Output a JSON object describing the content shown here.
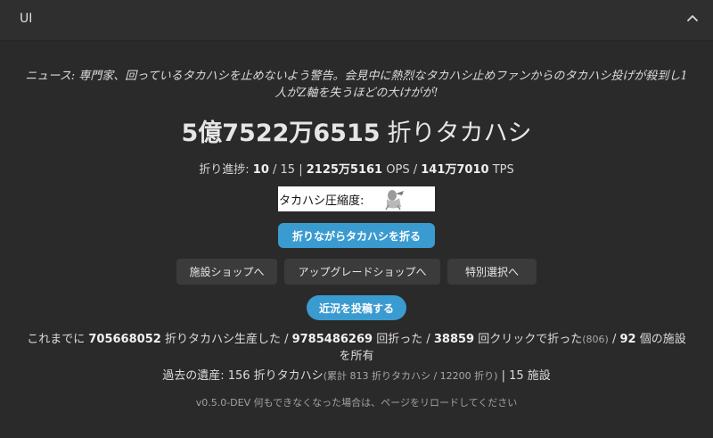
{
  "window": {
    "title": "UI"
  },
  "news": "ニュース: 専門家、回っているタカハシを止めないよう警告。会見中に熱烈なタカハシ止めファンからのタカハシ投げが殺到し1人がZ軸を失うほどの大けがが!",
  "counter": {
    "value": "5億7522万6515",
    "unit": "折りタカハシ"
  },
  "progress": {
    "label": "折り進捗:",
    "current": "10",
    "sep1": "/ 15 |",
    "ops": "2125万5161",
    "ops_unit": "OPS /",
    "tps": "141万7010",
    "tps_unit": "TPS"
  },
  "compress": {
    "label": "タカハシ圧縮度:"
  },
  "buttons": {
    "fold": "折りながらタカハシを折る",
    "facility_shop": "施設ショップへ",
    "upgrade_shop": "アップグレードショップへ",
    "special": "特別選択へ",
    "post": "近況を投稿する"
  },
  "stats": {
    "t1": "これまでに",
    "produced": "705668052",
    "t2": "折りタカハシ生産した /",
    "rotations": "9785486269",
    "t3": "回折った /",
    "clicks": "38859",
    "t4": "回クリックで折った",
    "clicks_paren": "(806)",
    "t5": "/",
    "facilities": "92",
    "t6": "個の施設を所有"
  },
  "legacy": {
    "label": "過去の遺産: 156 折りタカハシ",
    "detail": "(累計 813 折りタカハシ / 12200 折り)",
    "suffix": "| 15 施設"
  },
  "version": "v0.5.0-DEV 何もできなくなった場合は、ページをリロードしてください",
  "icons": {
    "collapse": "chevron-up-icon",
    "compress_image": "takahashi-figure-icon"
  }
}
